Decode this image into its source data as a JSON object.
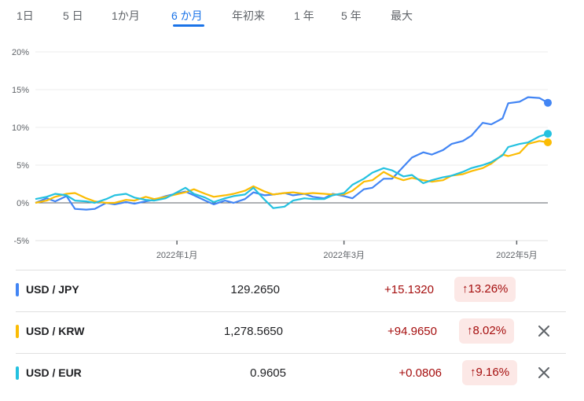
{
  "tabs": [
    {
      "label": "1日"
    },
    {
      "label": "5 日"
    },
    {
      "label": "1か月"
    },
    {
      "label": "6 か月",
      "active": true
    },
    {
      "label": "年初来"
    },
    {
      "label": "1 年"
    },
    {
      "label": "5 年"
    },
    {
      "label": "最大"
    }
  ],
  "chart_data": {
    "type": "line",
    "ylim": [
      -5,
      20
    ],
    "y_ticks": [
      20,
      15,
      10,
      5,
      0,
      -5
    ],
    "y_tick_labels": [
      "20%",
      "15%",
      "10%",
      "5%",
      "0%",
      "-5%"
    ],
    "x_range": [
      "2021-11-12",
      "2022-05-12"
    ],
    "x_ticks": [
      {
        "date": "2022-01-01",
        "label": "2022年1月"
      },
      {
        "date": "2022-03-01",
        "label": "2022年3月"
      },
      {
        "date": "2022-05-01",
        "label": "2022年5月"
      }
    ],
    "grid": true,
    "series": [
      {
        "name": "USD / JPY",
        "color": "#4285f4",
        "points": [
          [
            "2021-11-12",
            0.0
          ],
          [
            "2021-11-16",
            0.6
          ],
          [
            "2021-11-19",
            0.2
          ],
          [
            "2021-11-23",
            0.9
          ],
          [
            "2021-11-26",
            -0.8
          ],
          [
            "2021-11-30",
            -0.9
          ],
          [
            "2021-12-03",
            -0.8
          ],
          [
            "2021-12-07",
            0.0
          ],
          [
            "2021-12-10",
            -0.2
          ],
          [
            "2021-12-14",
            0.1
          ],
          [
            "2021-12-17",
            -0.1
          ],
          [
            "2021-12-21",
            0.2
          ],
          [
            "2021-12-24",
            0.4
          ],
          [
            "2021-12-28",
            0.9
          ],
          [
            "2022-01-04",
            1.5
          ],
          [
            "2022-01-07",
            1.0
          ],
          [
            "2022-01-11",
            0.3
          ],
          [
            "2022-01-14",
            -0.2
          ],
          [
            "2022-01-18",
            0.3
          ],
          [
            "2022-01-21",
            0.0
          ],
          [
            "2022-01-25",
            0.5
          ],
          [
            "2022-01-28",
            1.4
          ],
          [
            "2022-02-01",
            1.0
          ],
          [
            "2022-02-04",
            1.1
          ],
          [
            "2022-02-08",
            1.3
          ],
          [
            "2022-02-11",
            1.0
          ],
          [
            "2022-02-15",
            1.2
          ],
          [
            "2022-02-18",
            0.8
          ],
          [
            "2022-02-22",
            0.6
          ],
          [
            "2022-02-25",
            1.2
          ],
          [
            "2022-03-01",
            0.9
          ],
          [
            "2022-03-04",
            0.6
          ],
          [
            "2022-03-08",
            1.8
          ],
          [
            "2022-03-11",
            2.0
          ],
          [
            "2022-03-15",
            3.2
          ],
          [
            "2022-03-18",
            3.2
          ],
          [
            "2022-03-22",
            4.8
          ],
          [
            "2022-03-25",
            6.0
          ],
          [
            "2022-03-29",
            6.7
          ],
          [
            "2022-04-01",
            6.4
          ],
          [
            "2022-04-05",
            7.0
          ],
          [
            "2022-04-08",
            7.8
          ],
          [
            "2022-04-12",
            8.2
          ],
          [
            "2022-04-15",
            8.9
          ],
          [
            "2022-04-19",
            10.6
          ],
          [
            "2022-04-22",
            10.4
          ],
          [
            "2022-04-26",
            11.2
          ],
          [
            "2022-04-28",
            13.2
          ],
          [
            "2022-05-02",
            13.4
          ],
          [
            "2022-05-05",
            14.0
          ],
          [
            "2022-05-09",
            13.9
          ],
          [
            "2022-05-12",
            13.26
          ]
        ]
      },
      {
        "name": "USD / KRW",
        "color": "#fbbc04",
        "points": [
          [
            "2021-11-12",
            0.0
          ],
          [
            "2021-11-16",
            0.3
          ],
          [
            "2021-11-19",
            0.8
          ],
          [
            "2021-11-23",
            1.2
          ],
          [
            "2021-11-26",
            1.3
          ],
          [
            "2021-11-30",
            0.6
          ],
          [
            "2021-12-03",
            0.2
          ],
          [
            "2021-12-07",
            0.0
          ],
          [
            "2021-12-10",
            0.0
          ],
          [
            "2021-12-14",
            0.4
          ],
          [
            "2021-12-17",
            0.3
          ],
          [
            "2021-12-21",
            0.8
          ],
          [
            "2021-12-24",
            0.5
          ],
          [
            "2021-12-28",
            0.8
          ],
          [
            "2022-01-04",
            1.4
          ],
          [
            "2022-01-07",
            1.8
          ],
          [
            "2022-01-11",
            1.2
          ],
          [
            "2022-01-14",
            0.8
          ],
          [
            "2022-01-18",
            1.0
          ],
          [
            "2022-01-21",
            1.2
          ],
          [
            "2022-01-25",
            1.6
          ],
          [
            "2022-01-28",
            2.2
          ],
          [
            "2022-02-01",
            1.5
          ],
          [
            "2022-02-04",
            1.1
          ],
          [
            "2022-02-08",
            1.3
          ],
          [
            "2022-02-11",
            1.4
          ],
          [
            "2022-02-15",
            1.2
          ],
          [
            "2022-02-18",
            1.3
          ],
          [
            "2022-02-22",
            1.2
          ],
          [
            "2022-02-25",
            1.1
          ],
          [
            "2022-03-01",
            1.1
          ],
          [
            "2022-03-04",
            1.6
          ],
          [
            "2022-03-08",
            2.8
          ],
          [
            "2022-03-11",
            3.0
          ],
          [
            "2022-03-15",
            4.1
          ],
          [
            "2022-03-18",
            3.5
          ],
          [
            "2022-03-22",
            3.0
          ],
          [
            "2022-03-25",
            3.3
          ],
          [
            "2022-03-29",
            3.0
          ],
          [
            "2022-04-01",
            2.8
          ],
          [
            "2022-04-05",
            3.0
          ],
          [
            "2022-04-08",
            3.6
          ],
          [
            "2022-04-12",
            3.8
          ],
          [
            "2022-04-15",
            4.2
          ],
          [
            "2022-04-19",
            4.6
          ],
          [
            "2022-04-22",
            5.2
          ],
          [
            "2022-04-26",
            6.4
          ],
          [
            "2022-04-28",
            6.2
          ],
          [
            "2022-05-02",
            6.6
          ],
          [
            "2022-05-05",
            7.8
          ],
          [
            "2022-05-09",
            8.2
          ],
          [
            "2022-05-12",
            8.02
          ]
        ]
      },
      {
        "name": "USD / EUR",
        "color": "#24c1e0",
        "points": [
          [
            "2021-11-12",
            0.5
          ],
          [
            "2021-11-16",
            0.8
          ],
          [
            "2021-11-19",
            1.2
          ],
          [
            "2021-11-23",
            1.0
          ],
          [
            "2021-11-26",
            0.3
          ],
          [
            "2021-11-30",
            0.2
          ],
          [
            "2021-12-03",
            0.0
          ],
          [
            "2021-12-07",
            0.5
          ],
          [
            "2021-12-10",
            1.0
          ],
          [
            "2021-12-14",
            1.2
          ],
          [
            "2021-12-17",
            0.7
          ],
          [
            "2021-12-21",
            0.4
          ],
          [
            "2021-12-24",
            0.3
          ],
          [
            "2021-12-28",
            0.6
          ],
          [
            "2022-01-04",
            2.0
          ],
          [
            "2022-01-07",
            1.2
          ],
          [
            "2022-01-11",
            0.7
          ],
          [
            "2022-01-14",
            0.1
          ],
          [
            "2022-01-18",
            0.6
          ],
          [
            "2022-01-21",
            0.9
          ],
          [
            "2022-01-25",
            1.1
          ],
          [
            "2022-01-28",
            2.0
          ],
          [
            "2022-02-01",
            0.4
          ],
          [
            "2022-02-04",
            -0.7
          ],
          [
            "2022-02-08",
            -0.5
          ],
          [
            "2022-02-11",
            0.3
          ],
          [
            "2022-02-15",
            0.6
          ],
          [
            "2022-02-18",
            0.5
          ],
          [
            "2022-02-22",
            0.5
          ],
          [
            "2022-02-25",
            1.0
          ],
          [
            "2022-03-01",
            1.3
          ],
          [
            "2022-03-04",
            2.4
          ],
          [
            "2022-03-08",
            3.2
          ],
          [
            "2022-03-11",
            4.0
          ],
          [
            "2022-03-15",
            4.6
          ],
          [
            "2022-03-18",
            4.3
          ],
          [
            "2022-03-22",
            3.5
          ],
          [
            "2022-03-25",
            3.7
          ],
          [
            "2022-03-29",
            2.6
          ],
          [
            "2022-04-01",
            3.0
          ],
          [
            "2022-04-05",
            3.4
          ],
          [
            "2022-04-08",
            3.6
          ],
          [
            "2022-04-12",
            4.1
          ],
          [
            "2022-04-15",
            4.6
          ],
          [
            "2022-04-19",
            5.0
          ],
          [
            "2022-04-22",
            5.4
          ],
          [
            "2022-04-26",
            6.3
          ],
          [
            "2022-04-28",
            7.4
          ],
          [
            "2022-05-02",
            7.8
          ],
          [
            "2022-05-05",
            8.0
          ],
          [
            "2022-05-09",
            8.8
          ],
          [
            "2022-05-12",
            9.16
          ]
        ]
      }
    ]
  },
  "rows": [
    {
      "pair": "USD / JPY",
      "color": "#4285f4",
      "price": "129.2650",
      "change": "+15.1320",
      "percent": "↑13.26%",
      "removable": false
    },
    {
      "pair": "USD / KRW",
      "color": "#fbbc04",
      "price": "1,278.5650",
      "change": "+94.9650",
      "percent": "↑8.02%",
      "removable": true
    },
    {
      "pair": "USD / EUR",
      "color": "#24c1e0",
      "price": "0.9605",
      "change": "+0.0806",
      "percent": "↑9.16%",
      "removable": true
    }
  ]
}
